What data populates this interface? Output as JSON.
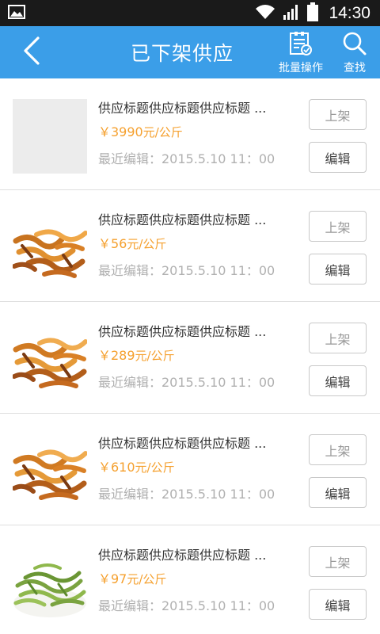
{
  "status_bar": {
    "time": "14:30",
    "icons": [
      "image-notification-icon",
      "wifi-icon",
      "signal-icon",
      "battery-icon"
    ]
  },
  "nav": {
    "title": "已下架供应",
    "back_icon": "chevron-left-icon",
    "batch_label": "批量操作",
    "batch_icon": "clipboard-check-icon",
    "search_label": "查找",
    "search_icon": "search-icon",
    "background_color": "#3b9ee8"
  },
  "colors": {
    "price": "#f5a02e",
    "muted_text": "#b0b0b0",
    "title_text": "#333333"
  },
  "items": [
    {
      "title": "供应标题供应标题供应标题 ...",
      "price": "￥3990",
      "unit": "元/公斤",
      "edited": "最近编辑：2015.5.10   11：00",
      "shelf_label": "上架",
      "edit_label": "编辑",
      "image": "placeholder"
    },
    {
      "title": "供应标题供应标题供应标题 ...",
      "price": "￥56",
      "unit": "元/公斤",
      "edited": "最近编辑：2015.5.10   11：00",
      "shelf_label": "上架",
      "edit_label": "编辑",
      "image": "dried-herb-slices"
    },
    {
      "title": "供应标题供应标题供应标题 ...",
      "price": "￥289",
      "unit": "元/公斤",
      "edited": "最近编辑：2015.5.10   11：00",
      "shelf_label": "上架",
      "edit_label": "编辑",
      "image": "dried-herb-slices"
    },
    {
      "title": "供应标题供应标题供应标题 ...",
      "price": "￥610",
      "unit": "元/公斤",
      "edited": "最近编辑：2015.5.10   11：00",
      "shelf_label": "上架",
      "edit_label": "编辑",
      "image": "dried-herb-slices"
    },
    {
      "title": "供应标题供应标题供应标题 ...",
      "price": "￥97",
      "unit": "元/公斤",
      "edited": "最近编辑：2015.5.10   11：00",
      "shelf_label": "上架",
      "edit_label": "编辑",
      "image": "green-herb-bowl"
    }
  ]
}
